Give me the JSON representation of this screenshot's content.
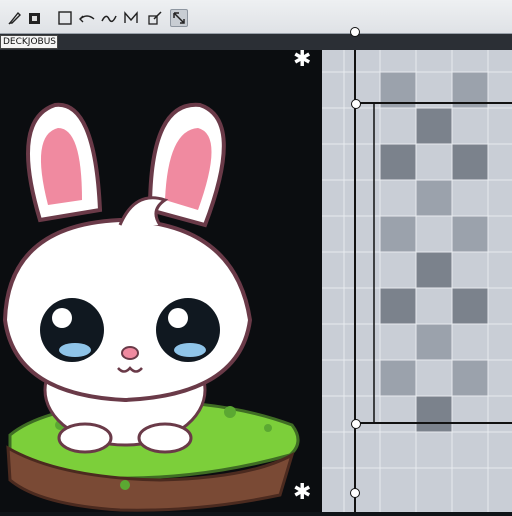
{
  "toolbar": {
    "tools": [
      {
        "name": "brush-icon",
        "glyph": "pen"
      },
      {
        "name": "fill-icon",
        "glyph": "bucket"
      },
      {
        "name": "rectangle-select-icon",
        "glyph": "rect"
      },
      {
        "name": "undo-icon",
        "glyph": "undo"
      },
      {
        "name": "smudge-icon",
        "glyph": "wave"
      },
      {
        "name": "transform-icon",
        "glyph": "grid"
      },
      {
        "name": "edit-icon",
        "glyph": "edit"
      },
      {
        "name": "lasso-icon",
        "glyph": "lasso"
      }
    ],
    "active_tool": "lasso-icon"
  },
  "layer": {
    "tab_label": "DECKJOBUS"
  },
  "colors": {
    "canvas_dark": "#0b0d10",
    "checker_light": "#c9ced6",
    "checker_mid": "#9ba2ac",
    "checker_dark": "#7b828c",
    "bunny_outline": "#6a3a48",
    "grass": "#7ccf3a",
    "dirt": "#7a4a35"
  }
}
